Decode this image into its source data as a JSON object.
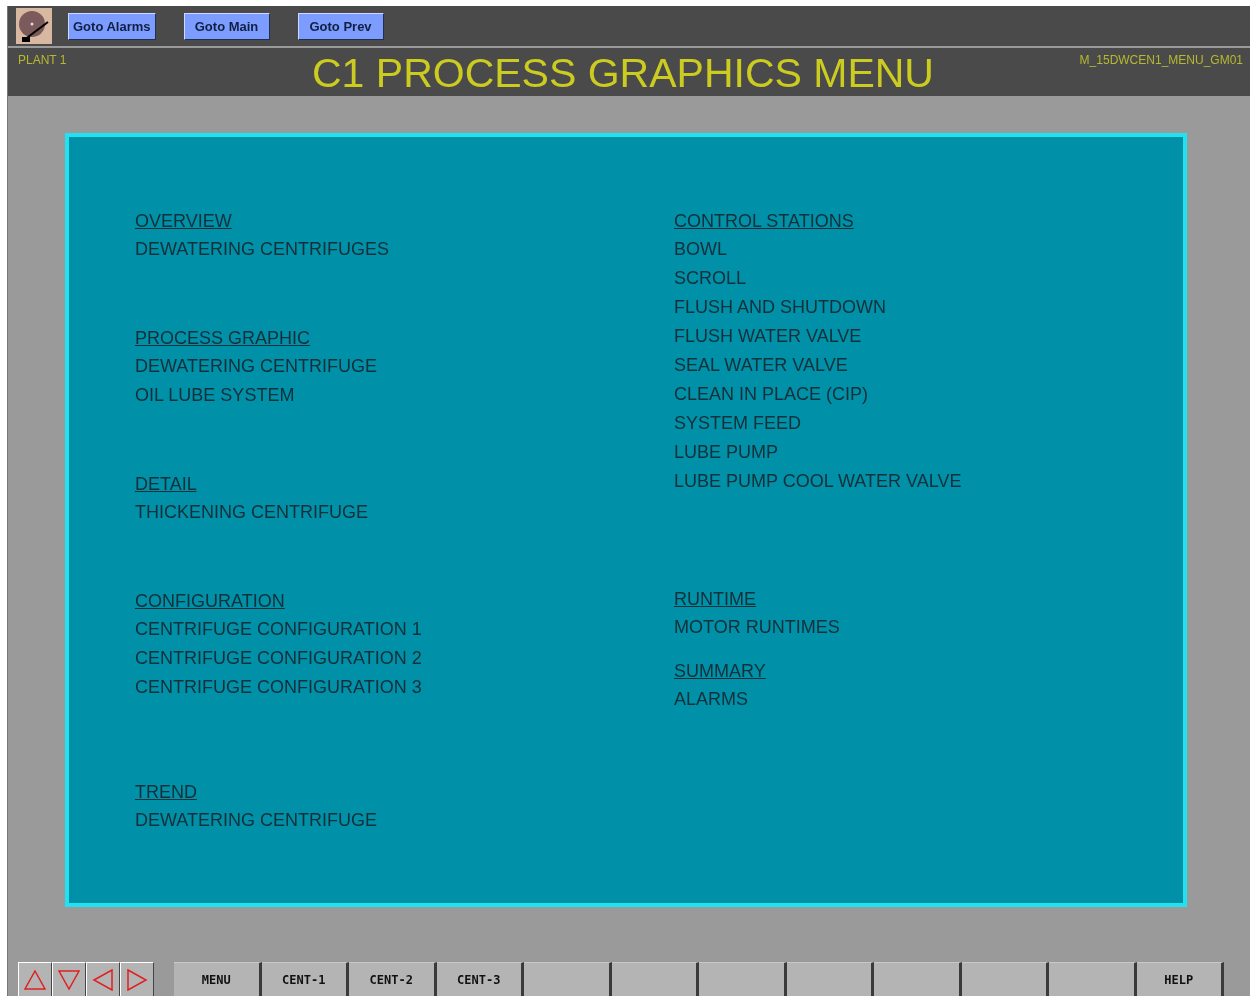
{
  "header": {
    "nav_buttons": [
      "Goto Alarms",
      "Goto Main",
      "Goto Prev"
    ],
    "plant": "PLANT 1",
    "title": "C1 PROCESS GRAPHICS MENU",
    "screen_id": "M_15DWCEN1_MENU_GM01"
  },
  "menu": {
    "left_column": [
      {
        "heading": "OVERVIEW",
        "items": [
          "DEWATERING CENTRIFUGES"
        ]
      },
      {
        "heading": "PROCESS GRAPHIC",
        "items": [
          "DEWATERING CENTRIFUGE",
          "OIL LUBE SYSTEM"
        ]
      },
      {
        "heading": "DETAIL",
        "items": [
          "THICKENING CENTRIFUGE"
        ]
      },
      {
        "heading": "CONFIGURATION",
        "items": [
          "CENTRIFUGE CONFIGURATION 1",
          "CENTRIFUGE CONFIGURATION 2",
          "CENTRIFUGE CONFIGURATION 3"
        ]
      },
      {
        "heading": "TREND",
        "items": [
          "DEWATERING CENTRIFUGE"
        ]
      }
    ],
    "right_column": [
      {
        "heading": "CONTROL STATIONS",
        "items": [
          "BOWL",
          "SCROLL",
          "FLUSH AND SHUTDOWN",
          "FLUSH WATER VALVE",
          "SEAL WATER VALVE",
          "CLEAN IN PLACE (CIP)",
          "SYSTEM FEED",
          "LUBE PUMP",
          "LUBE PUMP COOL WATER VALVE"
        ]
      },
      {
        "heading": "RUNTIME",
        "items": [
          "MOTOR RUNTIMES"
        ]
      },
      {
        "heading": "SUMMARY",
        "items": [
          "ALARMS"
        ]
      }
    ]
  },
  "footer": {
    "arrow_buttons": [
      {
        "kind": "up"
      },
      {
        "kind": "down"
      },
      {
        "kind": "left"
      },
      {
        "kind": "right"
      }
    ],
    "buttons": [
      {
        "kind": "labeled",
        "label": "MENU"
      },
      {
        "kind": "labeled",
        "label": "CENT-1"
      },
      {
        "kind": "labeled",
        "label": "CENT-2"
      },
      {
        "kind": "labeled",
        "label": "CENT-3"
      },
      {
        "kind": "blank"
      },
      {
        "kind": "blank"
      },
      {
        "kind": "blank"
      },
      {
        "kind": "blank"
      },
      {
        "kind": "blank"
      },
      {
        "kind": "blank"
      },
      {
        "kind": "blank"
      },
      {
        "kind": "labeled",
        "label": "HELP"
      }
    ]
  }
}
